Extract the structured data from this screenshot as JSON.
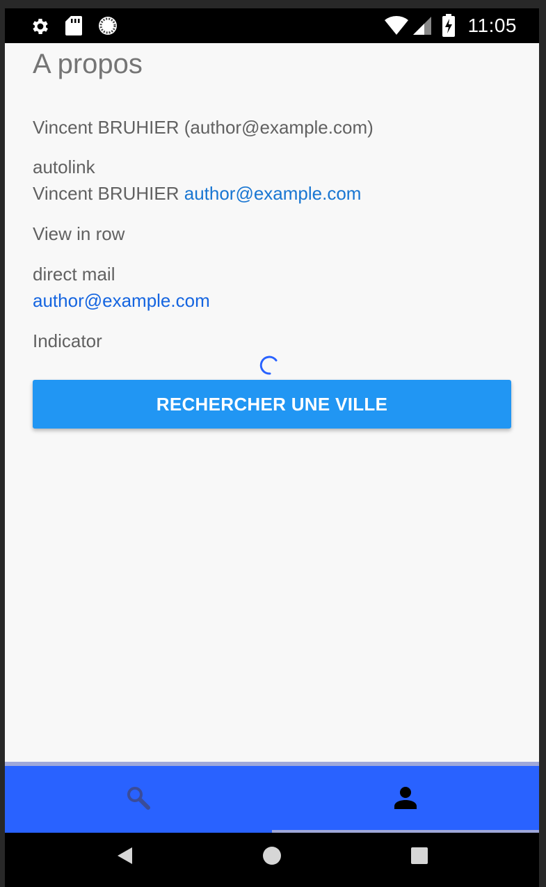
{
  "status_bar": {
    "time": "11:05",
    "left_icons": [
      "gear-icon",
      "sd-card-icon",
      "sync-icon"
    ],
    "right_icons": [
      "wifi-icon",
      "signal-icon",
      "battery-charging-icon"
    ]
  },
  "page": {
    "title": "A propos",
    "author_line": "Vincent BRUHIER (author@example.com)",
    "autolink_label": "autolink",
    "autolink_name": "Vincent BRUHIER",
    "autolink_email": "author@example.com",
    "view_in_row_label": "View in row",
    "direct_mail_label": "direct mail",
    "direct_mail_email": "author@example.com",
    "indicator_label": "Indicator",
    "search_button_label": "RECHERCHER UNE VILLE"
  },
  "tabs": [
    {
      "icon": "search-icon",
      "selected": false
    },
    {
      "icon": "person-icon",
      "selected": true
    }
  ],
  "colors": {
    "accent_button": "#2196f3",
    "tab_bar": "#2962ff",
    "link": "#1976d2",
    "tab_indicator": "#9fa8da"
  },
  "nav_bar": [
    "back-icon",
    "home-icon",
    "recents-icon"
  ]
}
